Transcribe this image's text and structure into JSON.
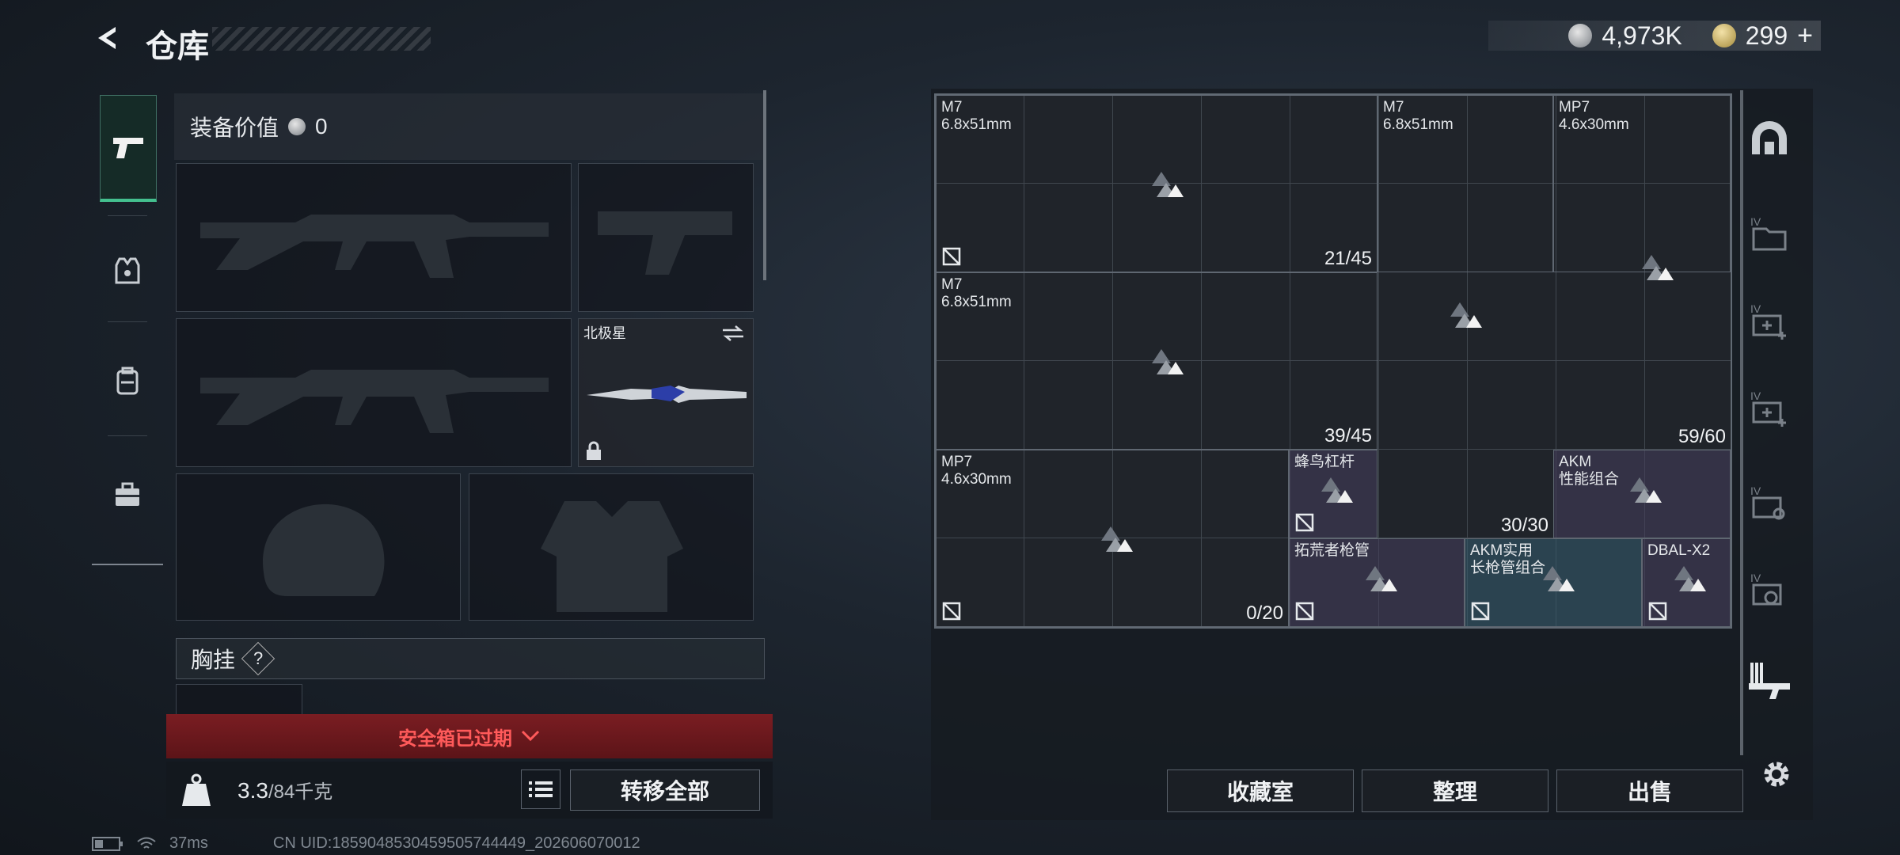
{
  "header": {
    "title": "仓库",
    "back_icon": "back-arrow-icon",
    "currency_1": "4,973K",
    "currency_2": "299",
    "currency_plus": "+"
  },
  "tabs": [
    {
      "name": "weapons",
      "icon": "pistol-icon",
      "active": true
    },
    {
      "name": "armor",
      "icon": "vest-icon",
      "active": false
    },
    {
      "name": "backpack",
      "icon": "backpack-icon",
      "active": false
    },
    {
      "name": "tools",
      "icon": "toolbox-icon",
      "active": false
    }
  ],
  "loadout": {
    "value_label": "装备价值",
    "value": "0",
    "melee_name": "北极星",
    "chest_label": "胸挂",
    "chest_help": "?",
    "secure_expired": "安全箱已过期",
    "weight_current": "3.3",
    "weight_max": "/84千克",
    "transfer_all": "转移全部"
  },
  "stash_items": [
    {
      "id": "m7-a",
      "name": "M7\n6.8x51mm",
      "count": "21/45",
      "style": "plain",
      "no_insure": true
    },
    {
      "id": "m7-b",
      "name": "M7\n6.8x51mm",
      "count": "",
      "style": "plain",
      "no_insure": false
    },
    {
      "id": "mp7-a",
      "name": "MP7\n4.6x30mm",
      "count": "",
      "style": "plain",
      "no_insure": false
    },
    {
      "id": "m7-c",
      "name": "M7\n6.8x51mm",
      "count": "39/45",
      "style": "plain",
      "no_insure": false
    },
    {
      "id": "center",
      "name": "",
      "count": "",
      "style": "plain",
      "no_insure": false
    },
    {
      "id": "mp7-a-count",
      "name": "",
      "count": "59/60",
      "style": "plain",
      "no_insure": false
    },
    {
      "id": "mp7-b",
      "name": "MP7\n4.6x30mm",
      "count": "0/20",
      "style": "plain",
      "no_insure": true
    },
    {
      "id": "lever",
      "name": "蜂鸟杠杆",
      "count": "",
      "style": "purple",
      "no_insure": true
    },
    {
      "id": "lever-count",
      "name": "",
      "count": "30/30",
      "style": "plain",
      "no_insure": false
    },
    {
      "id": "akm-combo",
      "name": "AKM\n性能组合",
      "count": "",
      "style": "purple",
      "no_insure": false
    },
    {
      "id": "barrel",
      "name": "拓荒者枪管",
      "count": "",
      "style": "purple",
      "no_insure": true
    },
    {
      "id": "akm-long",
      "name": "AKM实用\n长枪管组合",
      "count": "",
      "style": "teal",
      "no_insure": true
    },
    {
      "id": "dbal",
      "name": "DBAL-X2",
      "count": "",
      "style": "purple",
      "no_insure": true
    }
  ],
  "stash_actions": {
    "collection": "收藏室",
    "organize": "整理",
    "sell": "出售"
  },
  "rail_icons": [
    "stash-dome-icon",
    "iv-folder-icon",
    "iv-medkit-add-icon",
    "iv-medkit-add-icon-2",
    "iv-key-icon",
    "iv-gear-icon",
    "gun-rack-icon",
    "settings-gear-icon"
  ],
  "status": {
    "ping": "37ms",
    "uid": "CN UID:1859048530459505744449_202606070012"
  }
}
